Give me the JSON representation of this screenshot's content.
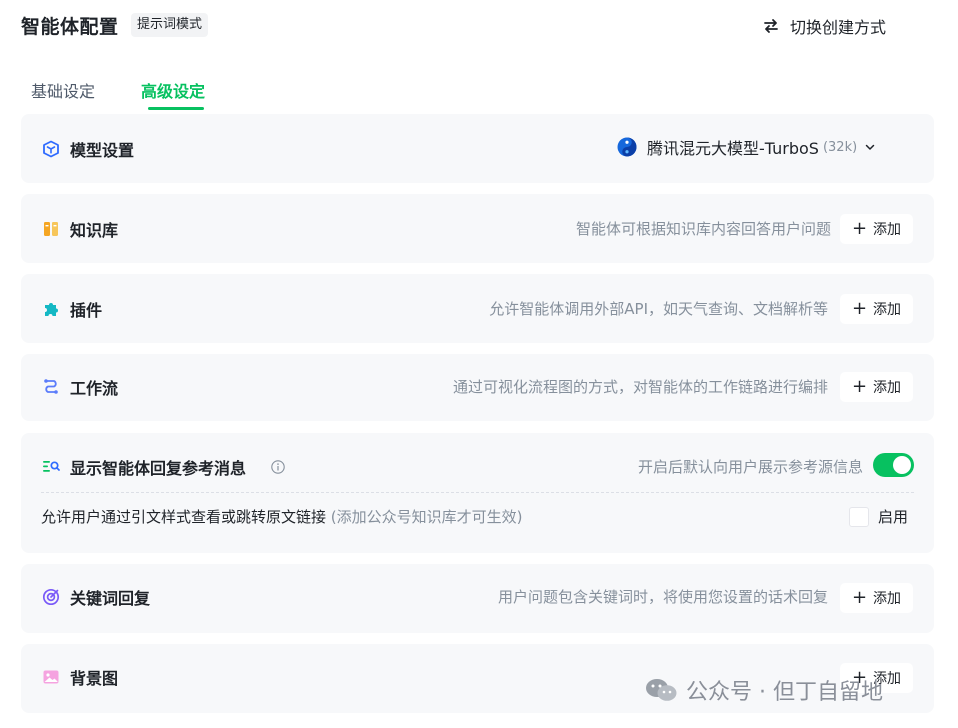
{
  "header": {
    "title": "智能体配置",
    "mode_badge": "提示词模式",
    "switch_label": "切换创建方式"
  },
  "tabs": [
    {
      "label": "基础设定",
      "active": false
    },
    {
      "label": "高级设定",
      "active": true
    }
  ],
  "accent_color": "#07c160",
  "sections": {
    "model": {
      "title": "模型设置",
      "model_name": "腾讯混元大模型-TurboS",
      "context": "(32k)"
    },
    "knowledge": {
      "title": "知识库",
      "desc": "智能体可根据知识库内容回答用户问题",
      "add_label": "添加"
    },
    "plugins": {
      "title": "插件",
      "desc": "允许智能体调用外部API，如天气查询、文档解析等",
      "add_label": "添加"
    },
    "workflow": {
      "title": "工作流",
      "desc": "通过可视化流程图的方式，对智能体的工作链路进行编排",
      "add_label": "添加"
    },
    "reference": {
      "title": "显示智能体回复参考消息",
      "desc": "开启后默认向用户展示参考源信息",
      "toggle_on": true,
      "sub_text": "允许用户通过引文样式查看或跳转原文链接",
      "sub_note": "(添加公众号知识库才可生效)",
      "checkbox_label": "启用",
      "checkbox_checked": false
    },
    "keyword": {
      "title": "关键词回复",
      "desc": "用户问题包含关键词时，将使用您设置的话术回复",
      "add_label": "添加"
    },
    "background": {
      "title": "背景图",
      "add_label": "添加"
    }
  },
  "watermark": {
    "text": "公众号 · 但丁自留地"
  }
}
